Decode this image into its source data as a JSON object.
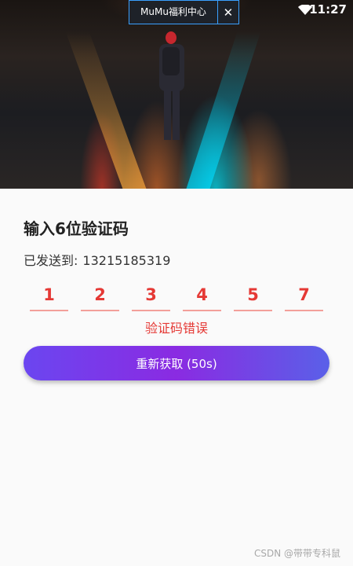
{
  "status_bar": {
    "time": "11:27",
    "wifi_icon": "wifi-icon"
  },
  "popup": {
    "title": "MuMu福利中心",
    "close_icon": "close-icon"
  },
  "hero": {
    "image": "night-street-walker-photo"
  },
  "verify": {
    "title": "输入6位验证码",
    "sent_label": "已发送到:",
    "phone": "13215185319",
    "digits": [
      "1",
      "2",
      "3",
      "4",
      "5",
      "7"
    ],
    "error": "验证码错误",
    "resend_label": "重新获取 (50s)"
  },
  "watermark": "CSDN @带带专科鼠",
  "colors": {
    "error": "#e53935",
    "button_start": "#6b46f0",
    "button_end": "#5a60e8"
  }
}
